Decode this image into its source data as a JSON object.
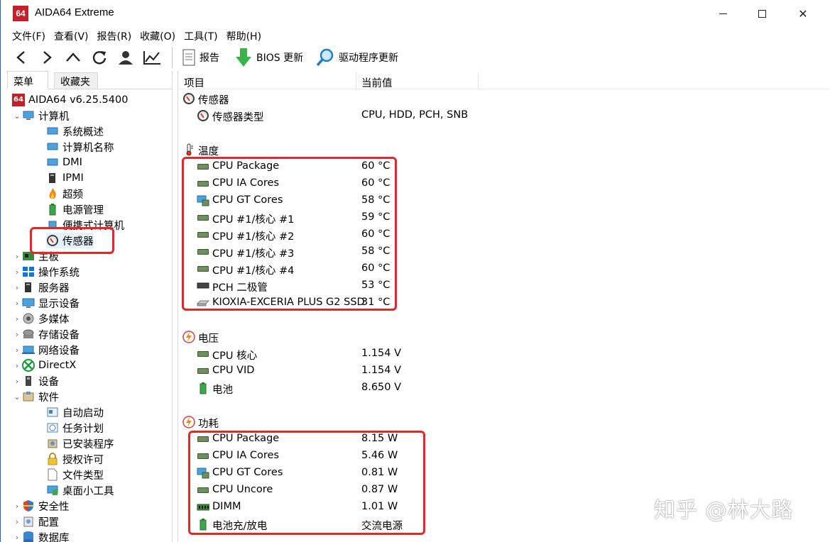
{
  "window": {
    "title": "AIDA64 Extreme",
    "logo_text": "64"
  },
  "menu": [
    "文件(F)",
    "查看(V)",
    "报告(R)",
    "收藏(O)",
    "工具(T)",
    "帮助(H)"
  ],
  "toolbar": {
    "report_label": "报告",
    "bios_label": "BIOS 更新",
    "driver_label": "驱动程序更新"
  },
  "left_tabs": {
    "menu": "菜单",
    "favorites": "收藏夹"
  },
  "tree": {
    "root": "AIDA64 v6.25.5400",
    "computer": "计算机",
    "computer_children": [
      "系统概述",
      "计算机名称",
      "DMI",
      "IPMI",
      "超频",
      "电源管理",
      "便携式计算机",
      "传感器"
    ],
    "top_items_a": [
      "主板",
      "操作系统",
      "服务器",
      "显示设备",
      "多媒体",
      "存储设备",
      "网络设备",
      "DirectX",
      "设备"
    ],
    "software": "软件",
    "software_children": [
      "自动启动",
      "任务计划",
      "已安装程序",
      "授权许可",
      "文件类型",
      "桌面小工具"
    ],
    "top_items_b": [
      "安全性",
      "配置",
      "数据库"
    ]
  },
  "columns": {
    "item": "项目",
    "value": "当前值"
  },
  "sections": {
    "sensor": {
      "title": "传感器",
      "rows": [
        {
          "label": "传感器类型",
          "value": "CPU, HDD, PCH, SNB"
        }
      ]
    },
    "temperature": {
      "title": "温度",
      "rows": [
        {
          "label": "CPU Package",
          "value": "60 °C"
        },
        {
          "label": "CPU IA Cores",
          "value": "60 °C"
        },
        {
          "label": "CPU GT Cores",
          "value": "58 °C"
        },
        {
          "label": "CPU #1/核心 #1",
          "value": "59 °C"
        },
        {
          "label": "CPU #1/核心 #2",
          "value": "60 °C"
        },
        {
          "label": "CPU #1/核心 #3",
          "value": "58 °C"
        },
        {
          "label": "CPU #1/核心 #4",
          "value": "60 °C"
        },
        {
          "label": "PCH 二极管",
          "value": "53 °C"
        },
        {
          "label": "KIOXIA-EXCERIA PLUS G2 SSD",
          "value": "31 °C"
        }
      ]
    },
    "voltage": {
      "title": "电压",
      "rows": [
        {
          "label": "CPU 核心",
          "value": "1.154 V"
        },
        {
          "label": "CPU VID",
          "value": "1.154 V"
        },
        {
          "label": "电池",
          "value": "8.650 V"
        }
      ]
    },
    "power": {
      "title": "功耗",
      "rows": [
        {
          "label": "CPU Package",
          "value": "8.15 W"
        },
        {
          "label": "CPU IA Cores",
          "value": "5.46 W"
        },
        {
          "label": "CPU GT Cores",
          "value": "0.81 W"
        },
        {
          "label": "CPU Uncore",
          "value": "0.87 W"
        },
        {
          "label": "DIMM",
          "value": "1.01 W"
        },
        {
          "label": "电池充/放电",
          "value": "交流电源"
        }
      ]
    }
  },
  "watermark": "知乎 @林大路",
  "colors": {
    "highlight": "#e8262a",
    "logo": "#c3202a",
    "window_border": "#1e62c8"
  }
}
